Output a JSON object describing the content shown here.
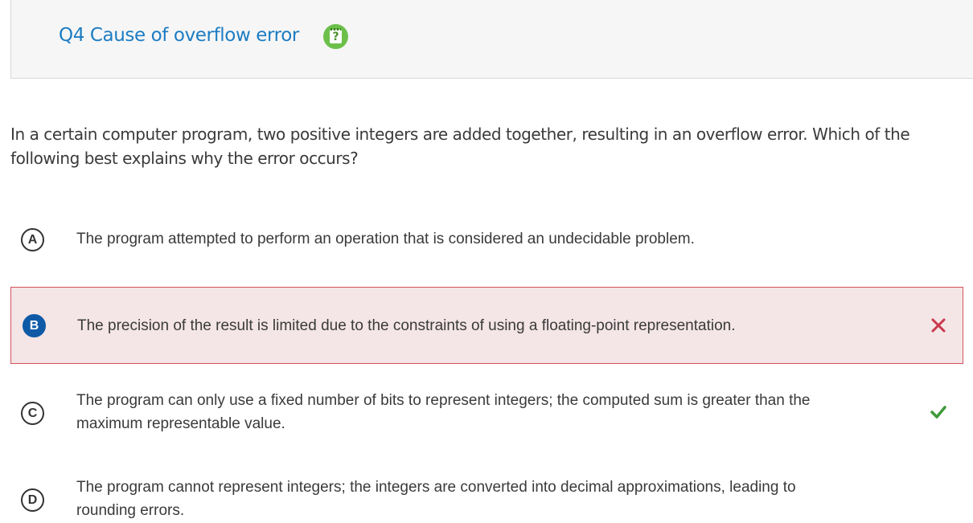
{
  "header": {
    "title": "Q4 Cause of overflow error",
    "help_icon": "notepad-question-icon"
  },
  "question": {
    "text": "In a certain computer program, two positive integers are added together, resulting in an overflow error. Which of the following best explains why the error occurs?"
  },
  "options": [
    {
      "letter": "A",
      "text": "The program attempted to perform an operation that is considered an undecidable problem.",
      "state": "unselected"
    },
    {
      "letter": "B",
      "text": "The precision of the result is limited due to the constraints of using a floating-point representation.",
      "state": "selected-incorrect",
      "mark_icon": "cross-icon"
    },
    {
      "letter": "C",
      "text": "The program can only use a fixed number of bits to represent integers; the computed sum is greater than the maximum representable value.",
      "state": "correct",
      "mark_icon": "check-icon"
    },
    {
      "letter": "D",
      "text": "The program cannot represent integers; the integers are converted into decimal approximations, leading to rounding errors.",
      "state": "unselected"
    }
  ],
  "colors": {
    "title": "#1c7cc2",
    "help_icon": "#6cc04a",
    "selected_badge": "#0e5aa7",
    "incorrect_bg": "#f4e5e6",
    "incorrect_border": "#d4525d",
    "incorrect_mark": "#c9374a",
    "correct_mark": "#3d9a3a"
  }
}
